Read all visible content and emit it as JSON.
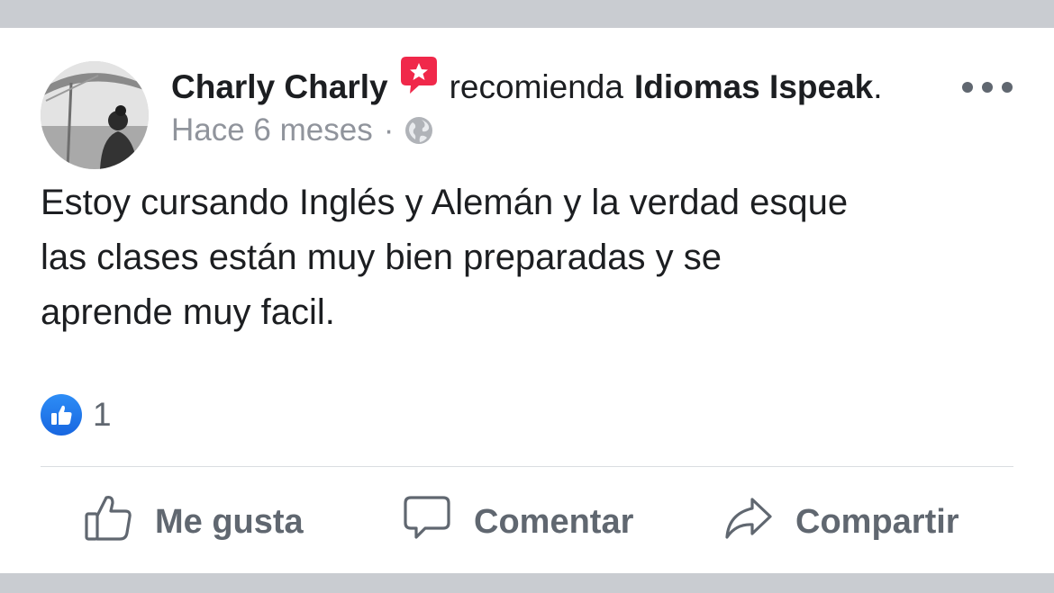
{
  "post": {
    "author": "Charly Charly",
    "recommend_text": "recomienda",
    "page_name": "Idiomas Ispeak",
    "page_name_suffix": ".",
    "time": "Hace 6 meses",
    "separator": "·",
    "privacy_icon": "globe-icon",
    "recommend_icon": "recommend-badge-icon",
    "text_lines": [
      "Estoy cursando Inglés y Alemán y la verdad esque",
      "las clases están muy bien preparadas y se",
      "aprende muy facil."
    ]
  },
  "reactions": {
    "icon": "like-reaction-icon",
    "count": "1"
  },
  "actions": {
    "like_label": "Me gusta",
    "comment_label": "Comentar",
    "share_label": "Compartir"
  },
  "colors": {
    "accent_blue": "#1877f2",
    "recommend_red": "#f0284a",
    "text_primary": "#1c1e21",
    "text_secondary": "#606770",
    "meta_gray": "#90949c",
    "page_background": "#c9ccd1"
  }
}
